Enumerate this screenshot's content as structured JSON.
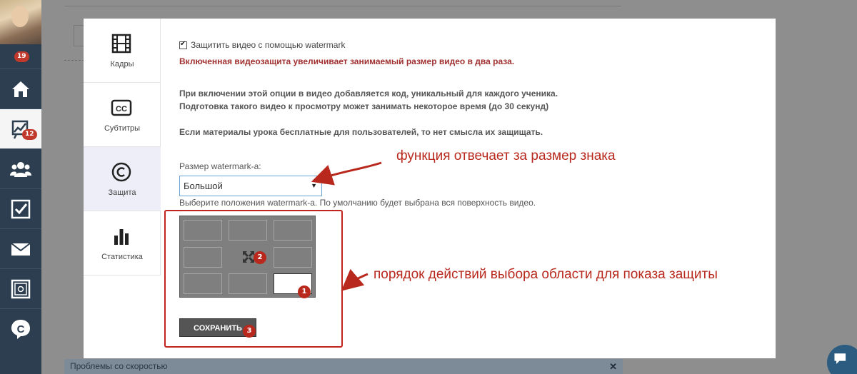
{
  "sidebar": {
    "notif_badge": "19",
    "chart_badge": "12",
    "items": [
      {
        "icon": "home-icon"
      },
      {
        "icon": "chart-icon"
      },
      {
        "icon": "users-icon"
      },
      {
        "icon": "checkbox-icon"
      },
      {
        "icon": "mail-icon"
      },
      {
        "icon": "safe-icon"
      },
      {
        "icon": "chat-c-icon"
      }
    ]
  },
  "modal": {
    "tabs": [
      {
        "label": "Кадры",
        "icon": "film-icon"
      },
      {
        "label": "Субтитры",
        "icon": "cc-icon"
      },
      {
        "label": "Защита",
        "icon": "copyright-icon"
      },
      {
        "label": "Статистика",
        "icon": "bar-chart-icon"
      }
    ],
    "protect_checkbox_label": "Защитить видео с помощью watermark",
    "protect_checked": true,
    "warning": "Включенная видеозащита увеличивает занимаемый размер видео в два раза.",
    "info_line1": "При включении этой опции в видео добавляется код, уникальный для каждого ученика.",
    "info_line2": "Подготовка такого видео к просмотру может занимать некоторое время (до 30 секунд)",
    "info_line3": "Если материалы урока бесплатные для пользователей, то нет смысла их защищать.",
    "size_label": "Размер watermark-а:",
    "size_value": "Большой",
    "position_hint": "Выберите положения watermark-а. По умолчанию будет выбрана вся поверхность видео.",
    "save_label": "СОХРАНИТЬ"
  },
  "annotations": {
    "size_note": "функция отвечает за размер знака",
    "order_note": "порядок действий выбора области для показа защиты",
    "step1": "1",
    "step2": "2",
    "step3": "3",
    "color": "#b8281c"
  },
  "bottom_bar": {
    "text": "Проблемы со скоростью",
    "close": "✕"
  }
}
